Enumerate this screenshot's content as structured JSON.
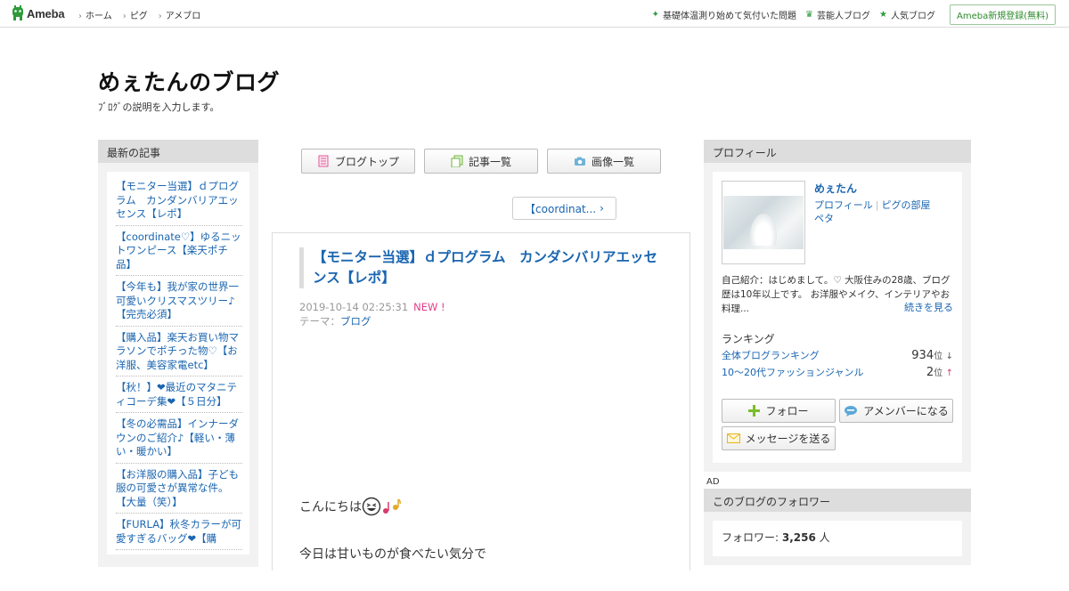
{
  "topbar": {
    "logo_text": "Ameba",
    "nav": [
      "ホーム",
      "ピグ",
      "アメブロ"
    ],
    "right_links": [
      "基礎体温測り始めて気付いた問題",
      "芸能人ブログ",
      "人気ブログ"
    ],
    "register_label": "Ameba新規登録(無料)"
  },
  "header": {
    "title": "めぇたんのブログ",
    "description": "ﾌﾞﾛｸﾞの説明を入力します。"
  },
  "left": {
    "heading": "最新の記事",
    "entries": [
      "【モニター当選】ｄプログラム　カンダンバリアエッセンス【レポ】",
      "【coordinate♡】ゆるニットワンピース【楽天ポチ品】",
      "【今年も】我が家の世界一可愛いクリスマスツリー♪【完売必須】",
      "【購入品】楽天お買い物マラソンでポチった物♡【お洋服、美容家電etc】",
      "【秋！】❤最近のマタニティコーデ集❤【５日分】",
      "【冬の必需品】インナーダウンのご紹介♪【軽い・薄い・暖かい】",
      "【お洋服の購入品】子ども服の可愛さが異常な件。【大量（笑）】",
      "【FURLA】秋冬カラーが可愛すぎるバッグ❤【購"
    ]
  },
  "center": {
    "buttons": [
      "ブログトップ",
      "記事一覧",
      "画像一覧"
    ],
    "prev_link": "【coordinat...",
    "article": {
      "title": "【モニター当選】ｄプログラム　カンダンバリアエッセンス【レポ】",
      "date": "2019-10-14 02:25:31",
      "new_badge": "NEW !",
      "theme_label": "テーマ：",
      "theme": "ブログ",
      "body_line1": "こんにちは",
      "body_line2": "今日は甘いものが食べたい気分で"
    }
  },
  "right": {
    "profile_heading": "プロフィール",
    "name": "めぇたん",
    "link_profile": "プロフィール",
    "link_pig": "ピグの部屋",
    "link_peta": "ペタ",
    "intro": "自己紹介：はじめまして。♡ 大阪住みの28歳、ブログ歴は10年以上です。 お洋服やメイク、インテリアやお料理...",
    "more": "続きを見る",
    "ranking_heading": "ランキング",
    "ranking": [
      {
        "label": "全体ブログランキング",
        "value": "934",
        "unit": "位",
        "trend": "↓"
      },
      {
        "label": "10〜20代ファッションジャンル",
        "value": "2",
        "unit": "位",
        "trend": "↑"
      }
    ],
    "btn_follow": "フォロー",
    "btn_member": "アメンバーになる",
    "btn_message": "メッセージを送る",
    "ad_label": "AD",
    "followers_heading": "このブログのフォロワー",
    "followers_label": "フォロワー:",
    "followers_count": "3,256",
    "followers_unit": "人"
  },
  "colors": {
    "link": "#1a65b0",
    "ameba_green": "#2d9b3a",
    "new_badge": "#e43c8c",
    "panel_bg": "#f2f2f2",
    "panel_head": "#dddddd"
  }
}
